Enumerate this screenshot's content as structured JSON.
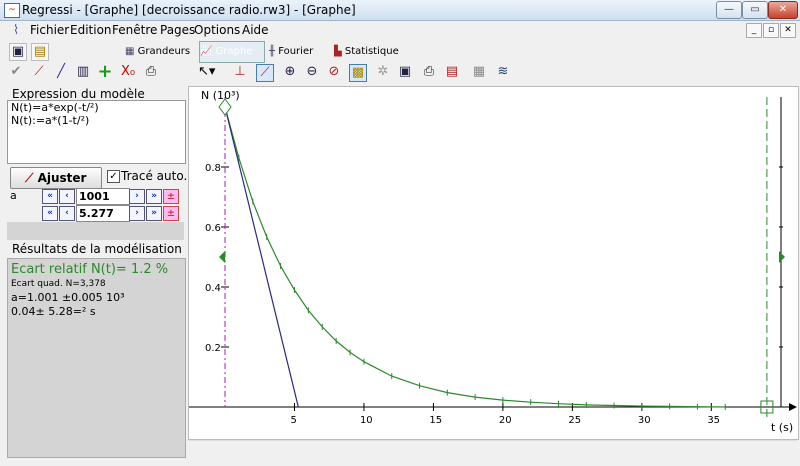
{
  "window": {
    "title": "Regressi  - [Graphe] [decroissance radio.rw3] - [Graphe]"
  },
  "menu": [
    "Fichier",
    "Edition",
    "Fenêtre",
    "Pages",
    "Options",
    "Aide"
  ],
  "pages": {
    "grandeurs": "Grandeurs",
    "graphe": "Graphe",
    "fourier": "Fourier",
    "statistique": "Statistique"
  },
  "model": {
    "header": "Expression du modèle",
    "lines": [
      "N(t)=a*exp(-t/²)",
      "N(t):=a*(1-t/²)"
    ]
  },
  "fit": {
    "button": "Ajuster",
    "auto_label": "Tracé auto.",
    "auto_checked": true
  },
  "params": [
    {
      "name": "a",
      "value": "1001"
    },
    {
      "name": "",
      "value": "5.277"
    }
  ],
  "results": {
    "header": "Résultats de la modélisation",
    "ecart_relatif": "Ecart relatif N(t)= 1.2 %",
    "ecart_quad": "Ecart quad. N=3,378",
    "a_line": "a=1.001 ±0.005 10³",
    "tau_line": "0.04± 5.28=² s"
  },
  "graph": {
    "ylabel": "N (10³)",
    "xlabel": "t (s)",
    "y_ticks": [
      "0.8",
      "0.6",
      "0.4",
      "0.2"
    ],
    "x_ticks": [
      "5",
      "10",
      "15",
      "20",
      "25",
      "30",
      "35"
    ]
  },
  "colors": {
    "model_green": "#2a8a2a",
    "tangent_blue": "#2a2a7a",
    "cursor_purple": "#aa22aa"
  },
  "chart_data": {
    "type": "line",
    "x_range": [
      0,
      40
    ],
    "y_range": [
      0,
      1
    ],
    "series": [
      {
        "values": [
          [
            0,
            1.0
          ],
          [
            1,
            0.83
          ],
          [
            2,
            0.685
          ],
          [
            3,
            0.567
          ],
          [
            4,
            0.47
          ],
          [
            5,
            0.39
          ],
          [
            6,
            0.322
          ],
          [
            7,
            0.267
          ],
          [
            8,
            0.22
          ],
          [
            9,
            0.182
          ],
          [
            10,
            0.151
          ],
          [
            12,
            0.103
          ],
          [
            14,
            0.071
          ],
          [
            16,
            0.048
          ],
          [
            18,
            0.033
          ],
          [
            20,
            0.023
          ],
          [
            22,
            0.016
          ],
          [
            24,
            0.011
          ],
          [
            26,
            0.007
          ],
          [
            28,
            0.005
          ],
          [
            30,
            0.003
          ],
          [
            32,
            0.002
          ],
          [
            34,
            0.001
          ],
          [
            36,
            0.0
          ]
        ]
      },
      {
        "values": [
          [
            0,
            1.0
          ],
          [
            5.277,
            0.0
          ]
        ]
      }
    ],
    "cursor_x": 0,
    "marker_x": 39
  }
}
